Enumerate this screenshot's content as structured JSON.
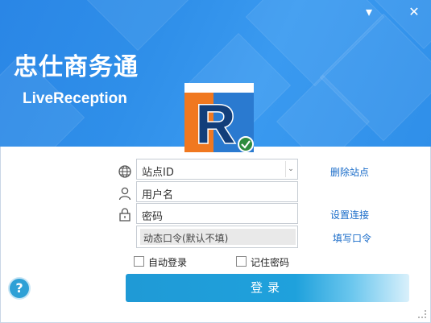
{
  "app": {
    "title": "忠仕商务通",
    "subtitle": "LiveReception"
  },
  "window_buttons": {
    "minimize": "▾",
    "close": "✕"
  },
  "form": {
    "site_id_placeholder": "站点ID",
    "username_placeholder": "用户名",
    "password_placeholder": "密码",
    "dynamic_code_placeholder": "动态口令(默认不填)",
    "dropdown_arrow": "⌄"
  },
  "links": {
    "delete_site": "删除站点",
    "settings_connection": "设置连接",
    "fill_code": "填写口令"
  },
  "checkboxes": {
    "auto_login": "自动登录",
    "remember_password": "记住密码"
  },
  "buttons": {
    "login": "登录",
    "help": "?"
  },
  "icons": {
    "globe": "globe-icon",
    "user": "user-icon",
    "lock": "lock-icon"
  },
  "colors": {
    "banner": "#2f8fe9",
    "login_button": "#1f9ad6",
    "link": "#1a6cc9"
  }
}
